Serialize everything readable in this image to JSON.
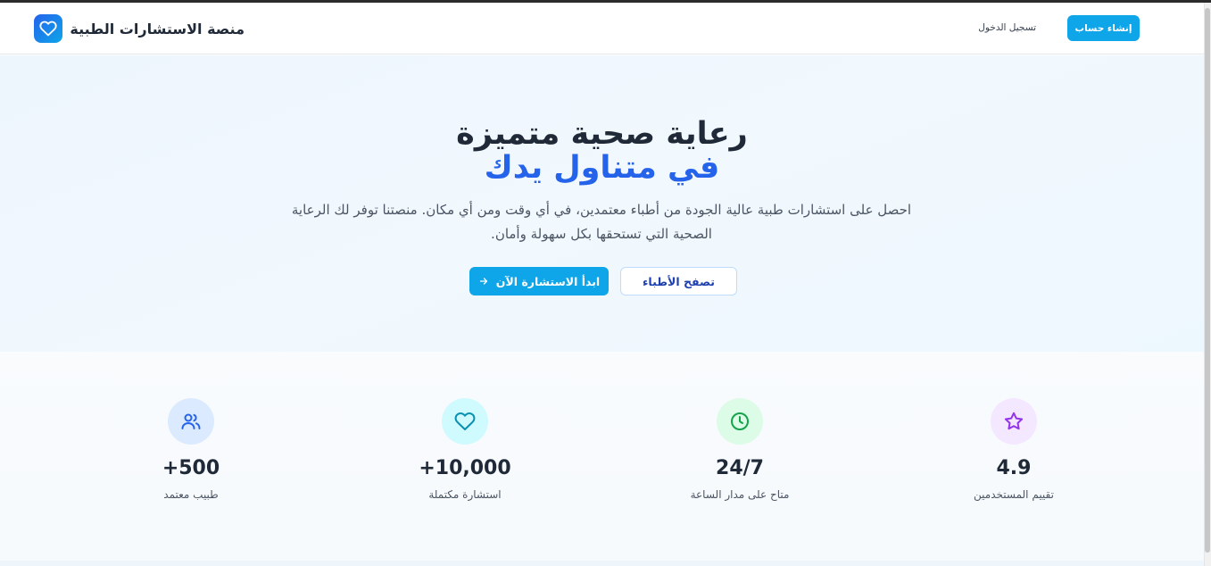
{
  "header": {
    "brand_name": "منصة الاستشارات الطبية",
    "login_label": "تسجيل الدخول",
    "signup_label": "إنشاء حساب"
  },
  "hero": {
    "title_line1": "رعاية صحية متميزة",
    "title_line2": "في متناول يدك",
    "description": "احصل على استشارات طبية عالية الجودة من أطباء معتمدين، في أي وقت ومن أي مكان. منصتنا توفر لك الرعاية الصحية التي تستحقها بكل سهولة وأمان.",
    "start_button": "ابدأ الاستشارة الآن",
    "browse_button": "تصفح الأطباء"
  },
  "stats": [
    {
      "value": "+500",
      "label": "طبيب معتمد",
      "icon": "users-icon",
      "color": "#2563eb",
      "bg": "#dbeafe"
    },
    {
      "value": "+10,000",
      "label": "استشارة مكتملة",
      "icon": "heart-icon",
      "color": "#0891b2",
      "bg": "#cffafe"
    },
    {
      "value": "24/7",
      "label": "متاح على مدار الساعة",
      "icon": "clock-icon",
      "color": "#16a34a",
      "bg": "#dcfce7"
    },
    {
      "value": "4.9",
      "label": "تقييم المستخدمين",
      "icon": "star-icon",
      "color": "#9333ea",
      "bg": "#f3e8ff"
    }
  ],
  "colors": {
    "primary": "#0ea5e9",
    "accent_blue": "#2563eb"
  }
}
